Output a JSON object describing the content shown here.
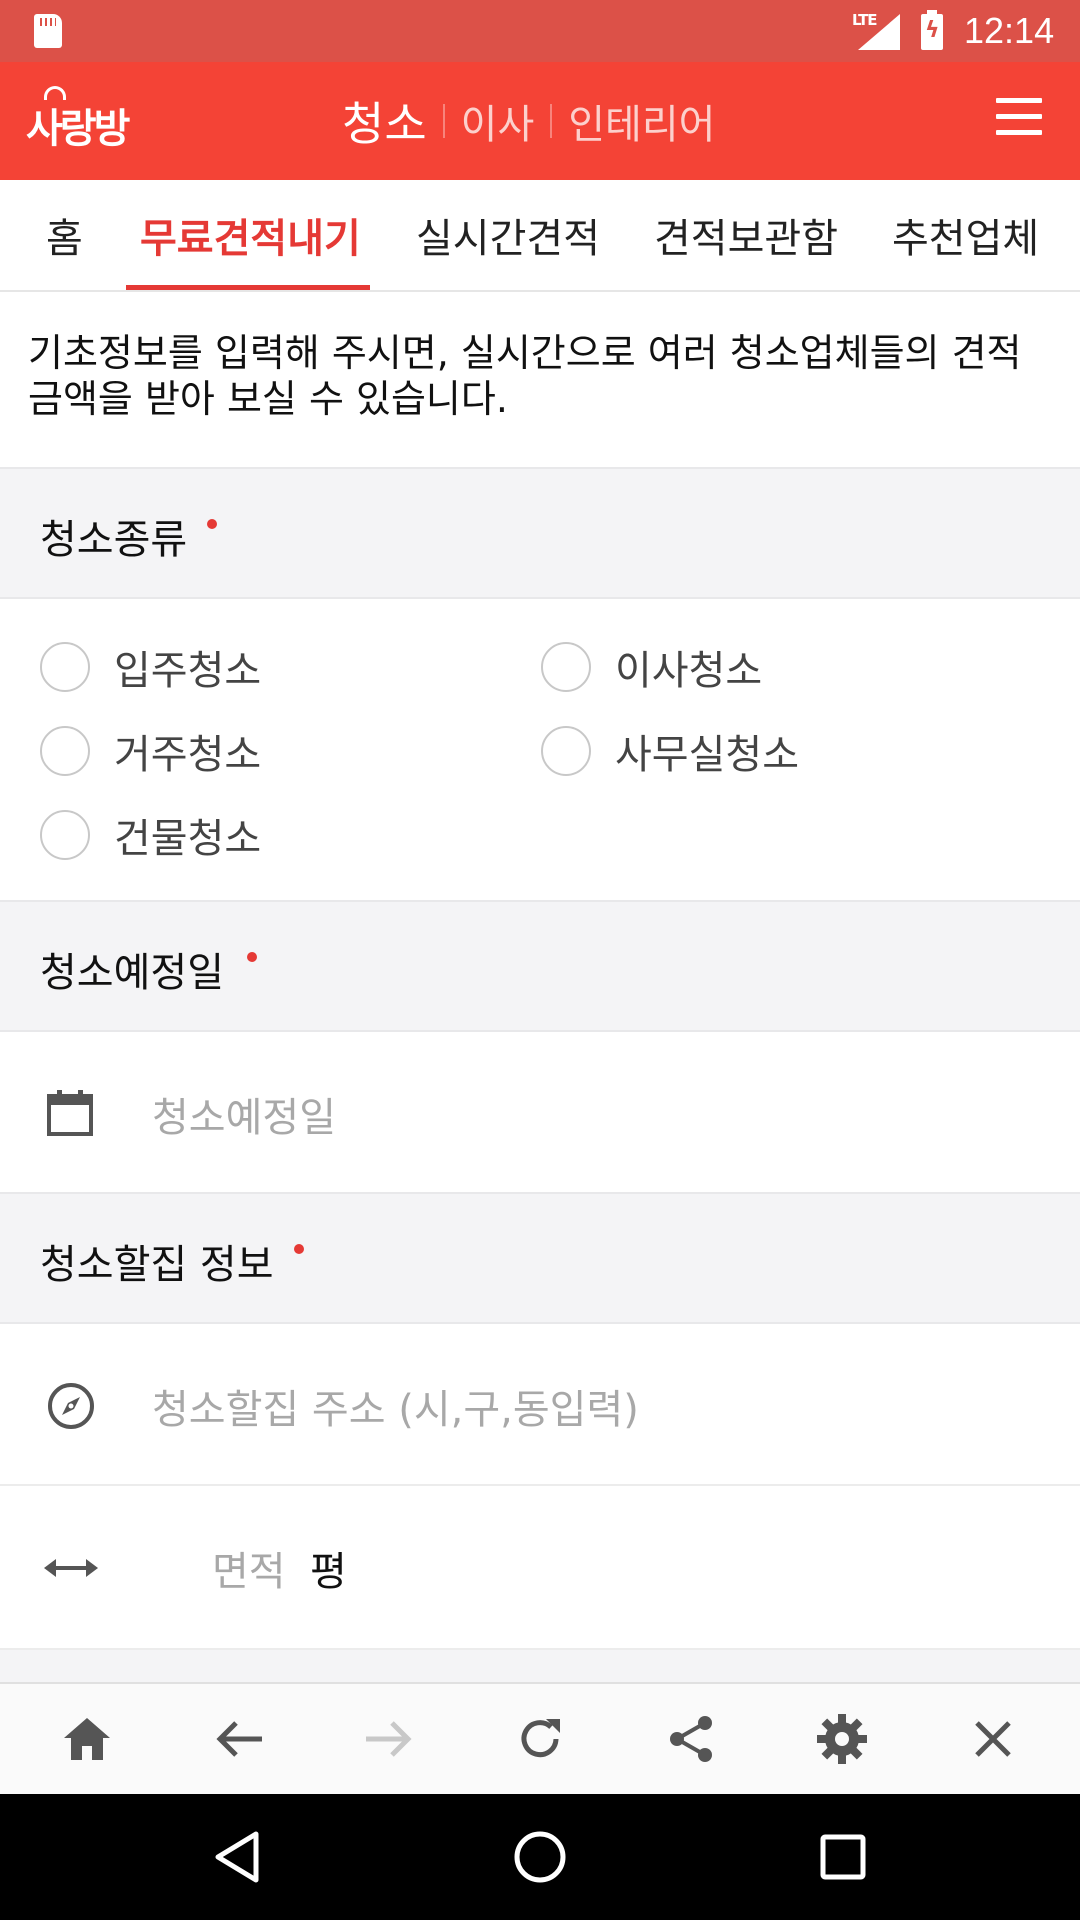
{
  "status_bar": {
    "network": "LTE",
    "time": "12:14"
  },
  "header": {
    "logo_text": "사랑방",
    "categories": [
      {
        "label": "청소",
        "active": true
      },
      {
        "label": "이사",
        "active": false
      },
      {
        "label": "인테리어",
        "active": false
      }
    ],
    "menu_icon": "hamburger-menu-icon"
  },
  "tabs": [
    {
      "label": "홈",
      "active": false
    },
    {
      "label": "무료견적내기",
      "active": true
    },
    {
      "label": "실시간견적",
      "active": false
    },
    {
      "label": "견적보관함",
      "active": false
    },
    {
      "label": "추천업체",
      "active": false
    }
  ],
  "intro": {
    "line1": "기초정보를 입력해 주시면, 실시간으로 여러 청소업체들의 견적",
    "line2": "금액을 받아 보실 수 있습니다."
  },
  "form": {
    "clean_type": {
      "title": "청소종류",
      "required": true,
      "options": [
        "입주청소",
        "이사청소",
        "거주청소",
        "사무실청소",
        "건물청소"
      ]
    },
    "schedule": {
      "title": "청소예정일",
      "required": true,
      "placeholder": "청소예정일",
      "icon": "calendar-icon"
    },
    "house_info": {
      "title": "청소할집 정보",
      "required": true,
      "address_placeholder": "청소할집 주소 (시,구,동입력)",
      "address_icon": "compass-icon",
      "area_placeholder": "면적",
      "area_unit": "평",
      "area_icon": "horizontal-arrows-icon"
    }
  },
  "toolbar": {
    "buttons": [
      "home-icon",
      "back-arrow-icon",
      "forward-arrow-icon",
      "refresh-icon",
      "share-icon",
      "settings-icon",
      "close-icon"
    ],
    "forward_enabled": false
  },
  "system_nav": [
    "back-triangle-icon",
    "home-circle-icon",
    "recents-square-icon"
  ],
  "colors": {
    "primary": "#f44336",
    "status_bar": "#dc5148",
    "accent_text": "#e53935",
    "section_bg": "#f4f4f6"
  }
}
